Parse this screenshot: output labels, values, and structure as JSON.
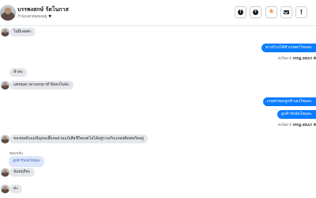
{
  "header": {
    "contact_name": "บรรพงสกษ์ ร้ตโนกาส",
    "status": "กำลังแตกต่อผ่องอยู่",
    "heart": "♥",
    "buttons": [
      "!",
      "↑",
      "★",
      "✉",
      "!"
    ]
  },
  "messages": {
    "m1": "ไม่มีเลยค่ะ",
    "out1": "ทางบ้านได้ทำเกษตรไหมคะ",
    "meta1_time": "ส่งโดย 6",
    "meta1_date": "กรกฎ ยกเบา 9",
    "m2": "ทำค่ะ",
    "m3": "แต่หมดเวลาแหงมาทำผิงคงไม่ค่ะ",
    "out2": "เกษตรของลูกค้าเองไหมคะ",
    "out3": "ลูกค้ารับจัดไหมคะ",
    "meta2_time": "ส่งโดย 6",
    "meta2_date": "กรกฎ ยกเบา 9",
    "m4": "ของหอดับแม่ปัญหอเสี้ยงมอ่วมแบ้เสียชีวิตเลยไม่ได้อยู่รวมกับแหล่งติดต่อกัยอยู่",
    "quote": "ลูกค้ารับจัดไหมคะ",
    "reply_tag": "ตอบกลับ",
    "m5": "จันทบุรีค่ะ",
    "m6": "ค่ะ"
  },
  "colors": {
    "outgoing": "#0a7cff",
    "incoming": "#e4e6eb",
    "accent_star": "#f7923a"
  }
}
